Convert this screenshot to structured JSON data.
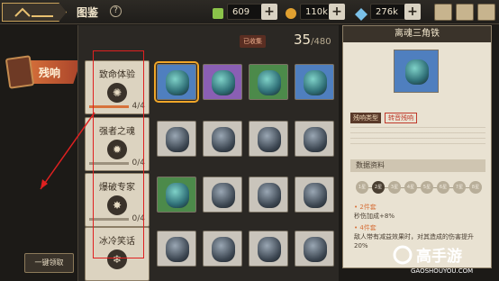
{
  "header": {
    "title": "图鉴",
    "help": "?",
    "resources": [
      {
        "name": "jade",
        "value": "609",
        "icon": "green-cube-icon",
        "color": "#8bc34a"
      },
      {
        "name": "gold",
        "value": "110k",
        "icon": "gold-coin-icon",
        "color": "#e0a030"
      },
      {
        "name": "crystal",
        "value": "276k",
        "icon": "crystal-icon",
        "color": "#7ac0e8"
      }
    ]
  },
  "sidebar": {
    "active_tab": "残响",
    "one_click_button": "一键领取"
  },
  "collection": {
    "label": "已收集",
    "count": "35",
    "total": "/480"
  },
  "categories": [
    {
      "name": "致命体验",
      "icon": "✺",
      "progress": "4/4",
      "fill": 1.0
    },
    {
      "name": "强者之魂",
      "icon": "✹",
      "progress": "0/4",
      "fill": 0.0
    },
    {
      "name": "爆破专家",
      "icon": "✸",
      "progress": "0/4",
      "fill": 0.0
    },
    {
      "name": "冰冷笑话",
      "icon": "❄",
      "progress": "0/4",
      "fill": 0.0
    }
  ],
  "detail": {
    "title": "离魂三角铁",
    "type_label": "残响类型",
    "type_value": "转音残响",
    "data_header": "数据资料",
    "levels": [
      "1星",
      "2星",
      "3星",
      "4星",
      "5星",
      "6星",
      "7星",
      "8星"
    ],
    "active_level": 1,
    "bonuses": [
      {
        "tier": "• 2件套",
        "text": "秒伤加成+8%"
      },
      {
        "tier": "• 4件套",
        "text": "敌人带有减益效果时，对其造成的伤害提升20%"
      }
    ]
  },
  "watermark": {
    "text": "高手游",
    "url": "GAOSHOUYOU.COM"
  }
}
